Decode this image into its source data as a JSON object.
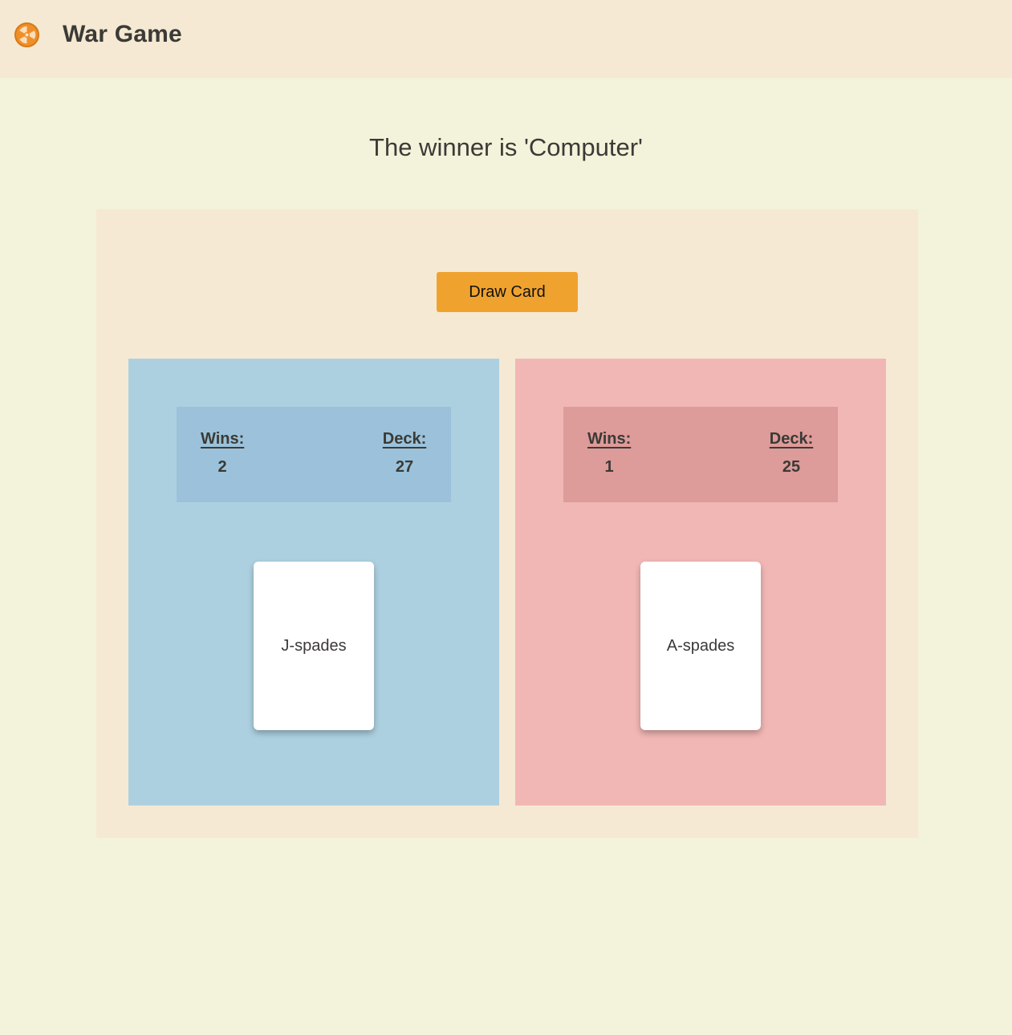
{
  "header": {
    "logo_icon": "radioactive-icon",
    "title": "War Game"
  },
  "status": {
    "winner_text": "The winner is 'Computer'"
  },
  "controls": {
    "draw_button_label": "Draw Card"
  },
  "players": [
    {
      "wins_label": "Wins:",
      "wins_value": "2",
      "deck_label": "Deck:",
      "deck_value": "27",
      "card": "J-spades",
      "panel_color": "#add0e0"
    },
    {
      "wins_label": "Wins:",
      "wins_value": "1",
      "deck_label": "Deck:",
      "deck_value": "25",
      "card": "A-spades",
      "panel_color": "#f1b7b5"
    }
  ],
  "colors": {
    "accent": "#f0a22f",
    "background": "#f3f2da",
    "header_background": "#f5e9d3"
  }
}
